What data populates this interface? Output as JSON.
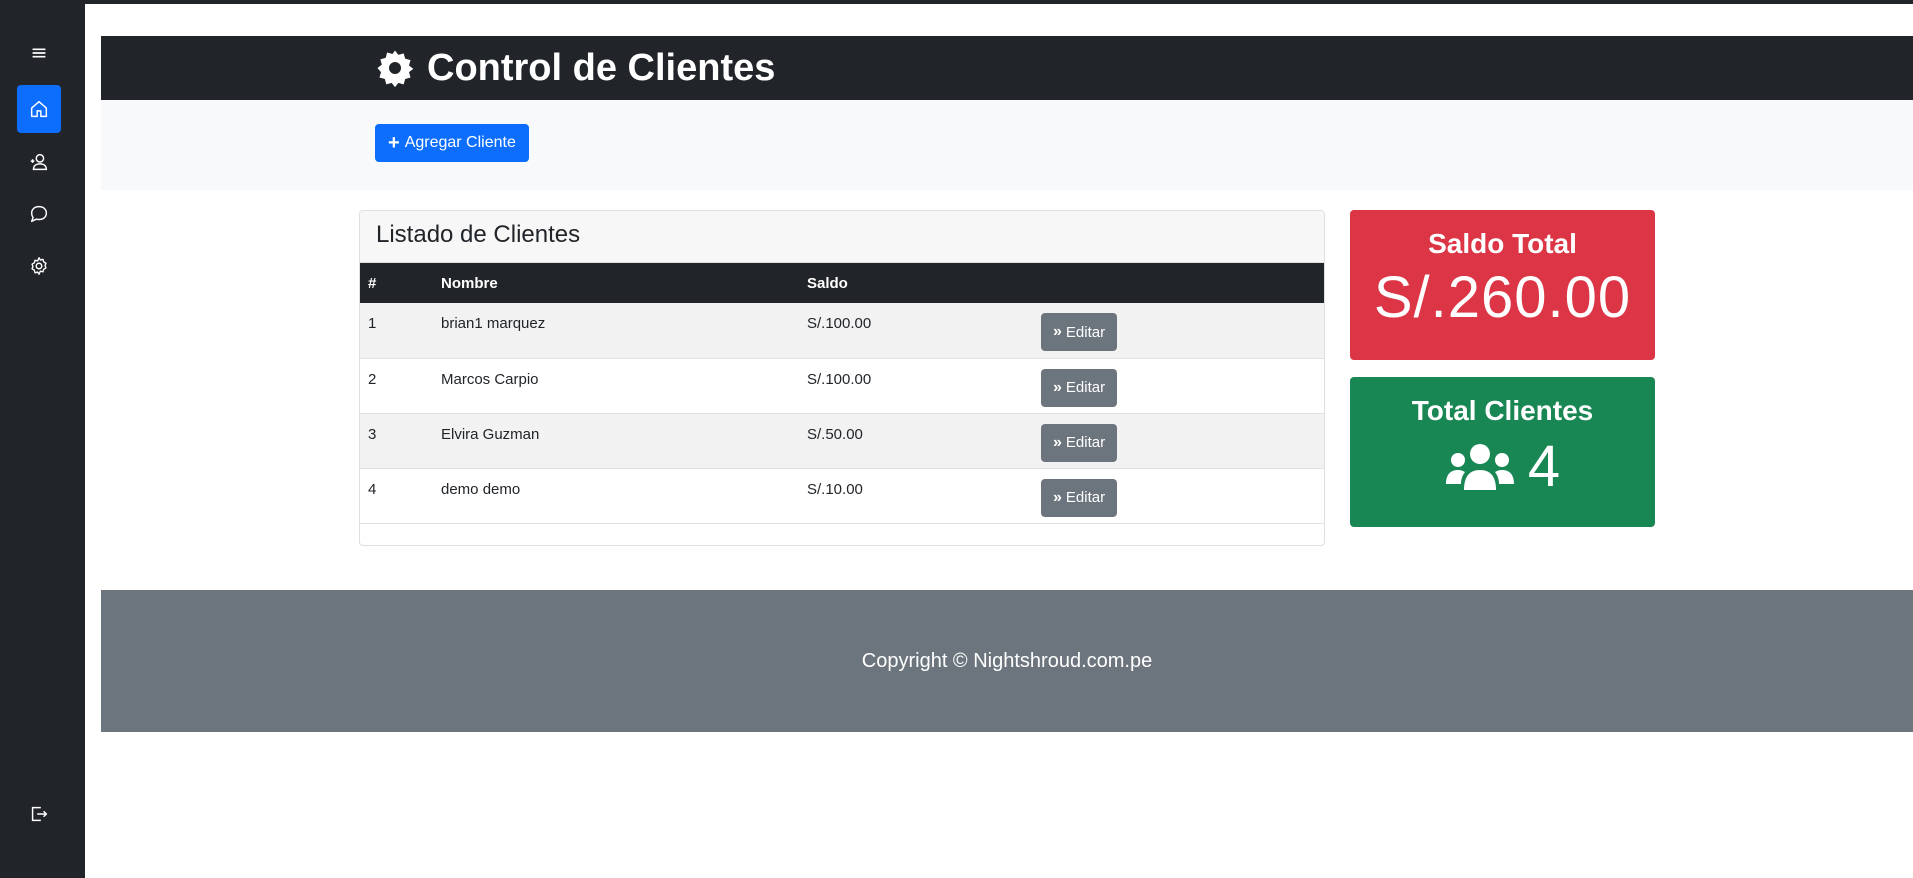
{
  "header": {
    "title": "Control de Clientes",
    "icon": "gear-icon"
  },
  "actions": {
    "add_label": "Agregar Cliente"
  },
  "sidebar": {
    "items": [
      {
        "name": "menu",
        "icon": "hamburger-icon"
      },
      {
        "name": "home",
        "icon": "home-icon",
        "active": true
      },
      {
        "name": "add-user",
        "icon": "user-add-icon"
      },
      {
        "name": "chat",
        "icon": "chat-icon"
      },
      {
        "name": "settings",
        "icon": "gear-icon"
      },
      {
        "name": "logout",
        "icon": "logout-icon"
      }
    ],
    "accent": "#0d6efd"
  },
  "clients": {
    "title": "Listado de Clientes",
    "columns": [
      "#",
      "Nombre",
      "Saldo",
      ""
    ],
    "rows": [
      {
        "id": "1",
        "name": "brian1 marquez",
        "saldo": "S/.100.00",
        "action": "Editar"
      },
      {
        "id": "2",
        "name": "Marcos Carpio",
        "saldo": "S/.100.00",
        "action": "Editar"
      },
      {
        "id": "3",
        "name": "Elvira Guzman",
        "saldo": "S/.50.00",
        "action": "Editar"
      },
      {
        "id": "4",
        "name": "demo demo",
        "saldo": "S/.10.00",
        "action": "Editar"
      }
    ]
  },
  "stats": {
    "saldo": {
      "title": "Saldo Total",
      "value": "S/.260.00",
      "color": "#dc3545"
    },
    "clientes": {
      "title": "Total Clientes",
      "value": "4",
      "icon": "users-icon",
      "color": "#198754"
    }
  },
  "footer": {
    "text": "Copyright © Nightshroud.com.pe"
  }
}
